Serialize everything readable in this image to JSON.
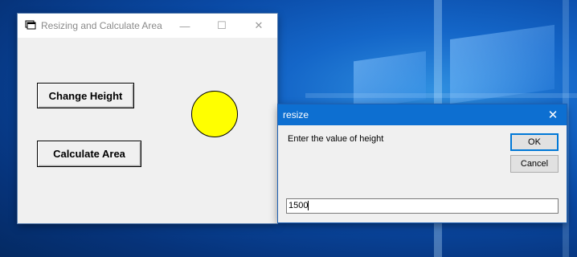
{
  "main_window": {
    "title": "Resizing and Calculate Area",
    "minimize_glyph": "—",
    "maximize_glyph": "☐",
    "close_glyph": "✕",
    "change_height_label": "Change Height",
    "calculate_area_label": "Calculate Area",
    "circle_color": "#ffff00"
  },
  "dialog": {
    "title": "resize",
    "close_glyph": "✕",
    "prompt": "Enter the value of height",
    "ok_label": "OK",
    "cancel_label": "Cancel",
    "input_value": "1500"
  }
}
